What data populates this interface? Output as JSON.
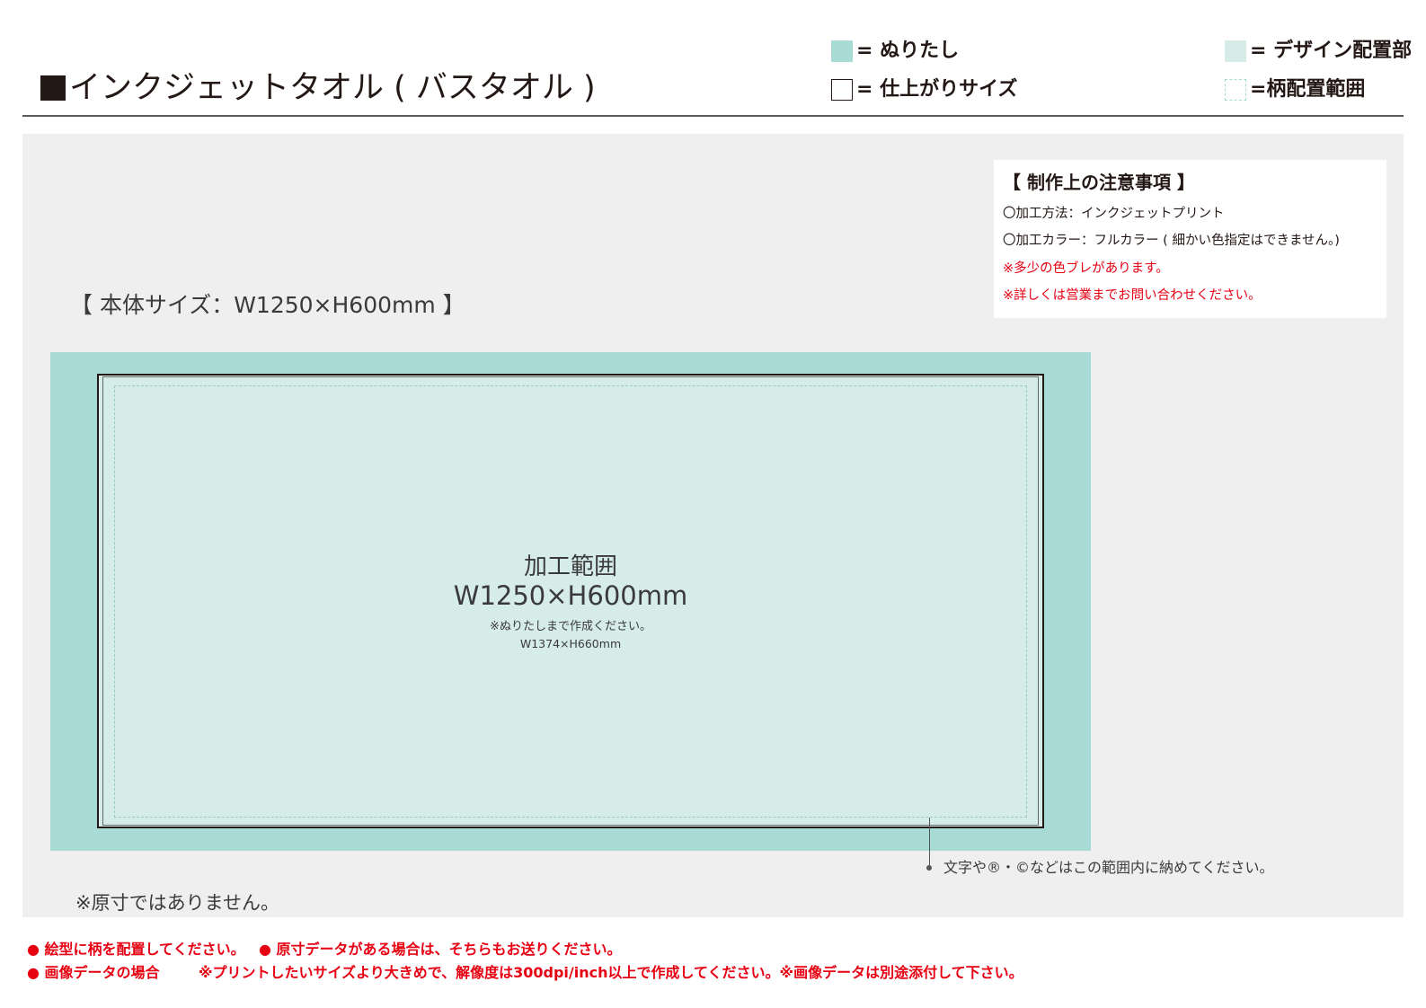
{
  "header": {
    "title": "インクジェットタオル ( バスタオル )",
    "legend": {
      "bleed_label": "= ぬりたし",
      "finish_label": "= 仕上がりサイズ",
      "design_label": "= デザイン配置部",
      "pattern_label": "=柄配置範囲"
    }
  },
  "notes": {
    "heading": "【 制作上の注意事項 】",
    "lines": [
      "〇加工方法：インクジェットプリント",
      "〇加工カラー：フルカラー ( 細かい色指定はできません。)",
      "※多少の色ブレがあります。",
      "※詳しくは営業までお問い合わせください。"
    ]
  },
  "template": {
    "body_size": "【 本体サイズ：W1250×H600mm 】",
    "area_label": "加工範囲",
    "area_size": "W1250×H600mm",
    "bleed_note": "※ぬりたしまで作成ください。",
    "bleed_size": "W1374×H660mm",
    "callout": "文字や®・©などはこの範囲内に納めてください。",
    "not_to_scale": "※原寸ではありません。"
  },
  "footer": {
    "line1a": "● 絵型に柄を配置してください。",
    "line1b": "● 原寸データがある場合は、そちらもお送りください。",
    "line2a": "● 画像データの場合",
    "line2b": "※プリントしたいサイズより大きめで、解像度は300dpi/inch以上で作成してください。※画像データは別途添付して下さい。"
  },
  "colors": {
    "bleed": "#a8dad6",
    "design_area": "#d6ece9",
    "panel": "#eeefee",
    "warning": "#e60012"
  }
}
